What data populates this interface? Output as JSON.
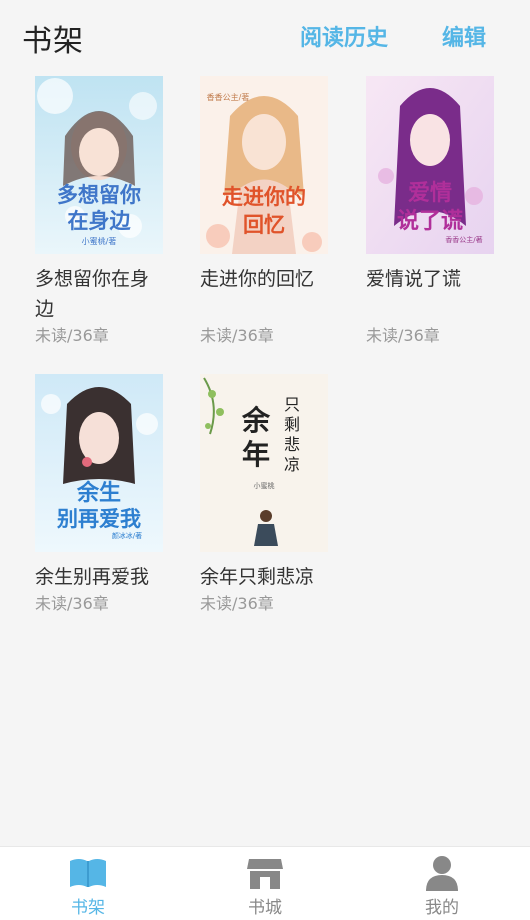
{
  "header": {
    "title": "书架",
    "history_label": "阅读历史",
    "edit_label": "编辑"
  },
  "books": [
    {
      "title": "多想留你在身边",
      "cover_text": "多想留你在身边",
      "cover_author": "小蜜桃/著",
      "status": "未读/36章"
    },
    {
      "title": "走进你的回忆",
      "cover_text": "走进你的回忆",
      "cover_author": "香香公主/著",
      "status": "未读/36章"
    },
    {
      "title": "爱情说了谎",
      "cover_text": "爱情说了谎",
      "cover_author": "香香公主/著",
      "status": "未读/36章"
    },
    {
      "title": "余生别再爱我",
      "cover_text": "余生别再爱我",
      "cover_author": "颜冰冰/著",
      "status": "未读/36章"
    },
    {
      "title": "余年只剩悲凉",
      "cover_text": "余年只剩悲凉",
      "cover_author": "小蜜桃",
      "status": "未读/36章"
    }
  ],
  "tabs": [
    {
      "label": "书架",
      "icon": "book-open-icon",
      "active": true
    },
    {
      "label": "书城",
      "icon": "store-icon",
      "active": false
    },
    {
      "label": "我的",
      "icon": "person-icon",
      "active": false
    }
  ],
  "colors": {
    "accent": "#55b6e6",
    "background": "#f5f5f5",
    "meta_text": "#999999"
  }
}
